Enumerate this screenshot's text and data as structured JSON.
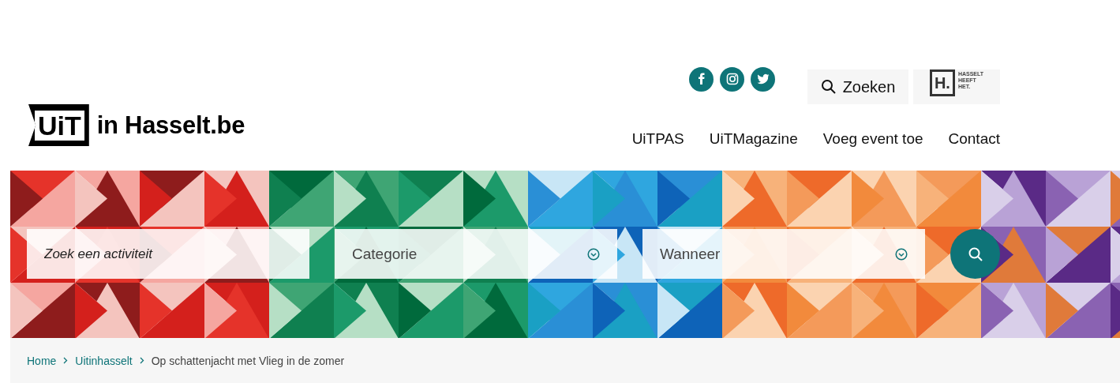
{
  "header": {
    "logo": {
      "mark": "UiT",
      "text": "in Hasselt.be"
    },
    "social": [
      {
        "kind": "facebook"
      },
      {
        "kind": "instagram"
      },
      {
        "kind": "twitter"
      }
    ],
    "search_button": "Zoeken",
    "city_logo": {
      "mark": "H.",
      "lines": [
        "HASSELT",
        "HEEFT",
        "HET."
      ]
    },
    "nav": [
      "UiTPAS",
      "UiTMagazine",
      "Voeg event toe",
      "Contact"
    ]
  },
  "search": {
    "fields": [
      {
        "kind": "text",
        "placeholder": "Zoek een activiteit"
      },
      {
        "kind": "select",
        "value": "Categorie"
      },
      {
        "kind": "select",
        "value": "Wanneer"
      }
    ]
  },
  "breadcrumb": [
    {
      "label": "Home",
      "link": true
    },
    {
      "label": "Uitinhasselt",
      "link": true
    },
    {
      "label": "Op schattenjacht met Vlieg in de zomer",
      "link": false
    }
  ]
}
